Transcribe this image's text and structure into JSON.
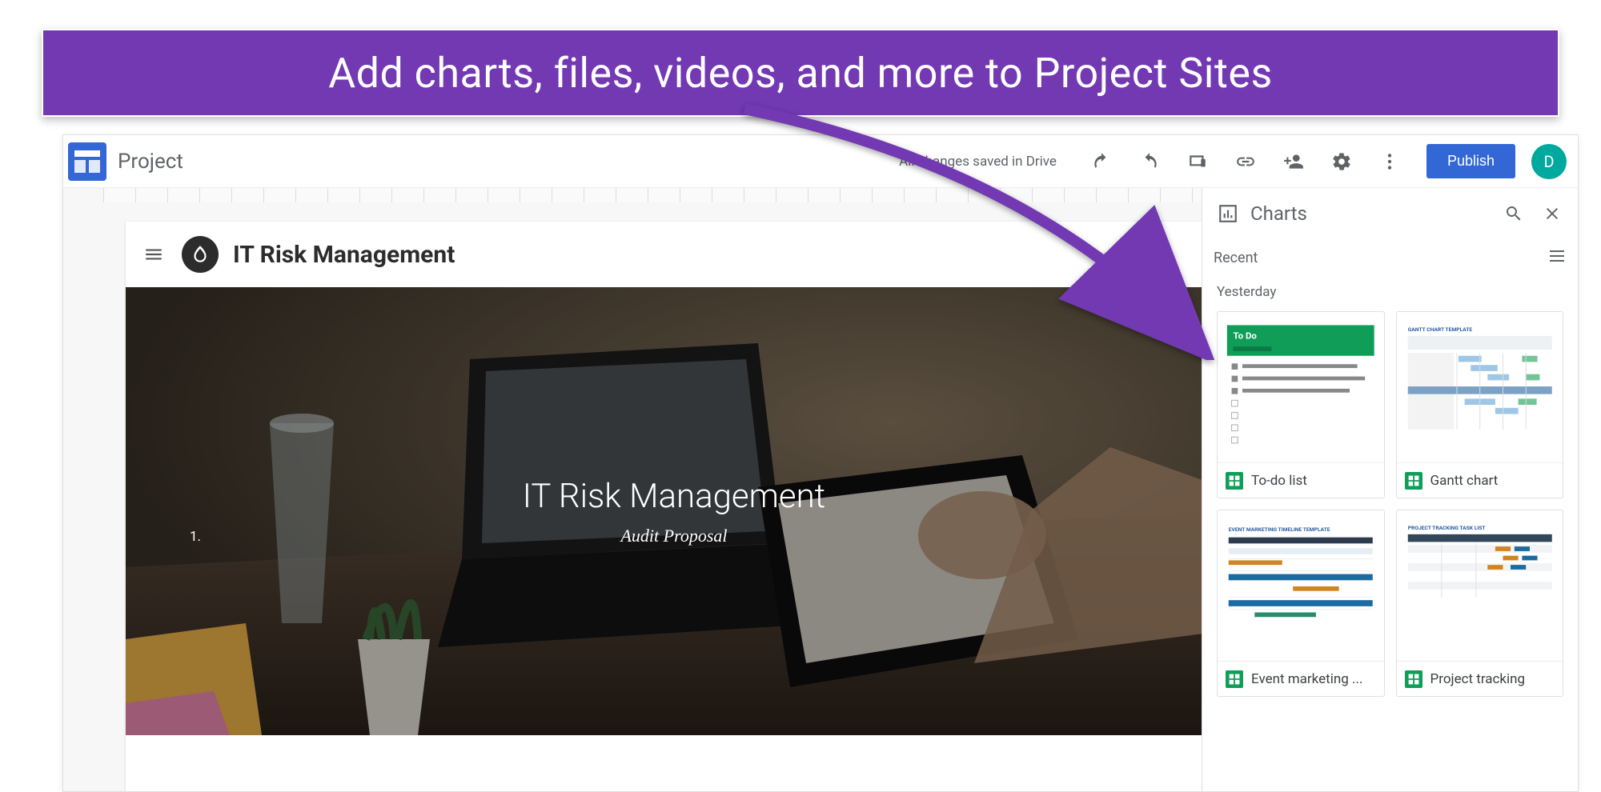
{
  "annotation": {
    "banner_text": "Add charts, files,  videos, and more to Project Sites"
  },
  "toolbar": {
    "doc_title": "Project",
    "save_status": "All changes saved in Drive",
    "publish_label": "Publish",
    "avatar_letter": "D"
  },
  "site": {
    "name": "IT Risk Management",
    "hero_title": "IT Risk Management",
    "hero_subtitle": "Audit Proposal",
    "list_number": "1."
  },
  "panel": {
    "title": "Charts",
    "recent_label": "Recent",
    "section_label": "Yesterday",
    "items": [
      {
        "label": "To-do list",
        "thumb_title": "To Do"
      },
      {
        "label": "Gantt chart",
        "thumb_title": "GANTT CHART TEMPLATE"
      },
      {
        "label": "Event marketing ...",
        "thumb_title": "EVENT MARKETING TIMELINE TEMPLATE"
      },
      {
        "label": "Project tracking",
        "thumb_title": "PROJECT TRACKING TASK LIST"
      }
    ]
  },
  "colors": {
    "accent_purple": "#7239b3",
    "publish_blue": "#3367d6",
    "avatar_teal": "#00a99d",
    "sheets_green": "#0f9d58"
  }
}
